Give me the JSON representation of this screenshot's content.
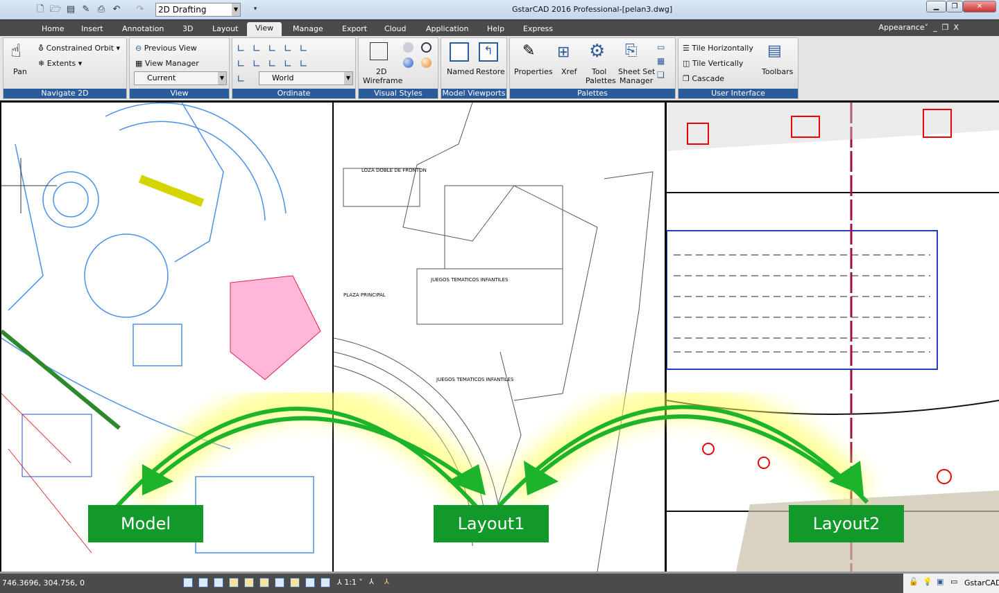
{
  "titlebar": {
    "title": "GstarCAD 2016 Professional-[pelan3.dwg]",
    "workspace": "2D Drafting",
    "quick_access": [
      "new-icon",
      "open-icon",
      "save-icon",
      "save-as-icon",
      "print-icon",
      "undo-icon",
      "redo-icon"
    ]
  },
  "tabs": [
    "Home",
    "Insert",
    "Annotation",
    "3D",
    "Layout",
    "View",
    "Manage",
    "Export",
    "Cloud",
    "Application",
    "Help",
    "Express"
  ],
  "active_tab": "View",
  "appearance": "Appearance",
  "ribbon": {
    "navigate": {
      "title": "Navigate 2D",
      "pan": "Pan",
      "orbit": "Constrained Orbit",
      "extents": "Extents"
    },
    "view": {
      "title": "View",
      "previous": "Previous View",
      "manager": "View Manager",
      "current": "Current"
    },
    "ordinate": {
      "title": "Ordinate",
      "ucs": "World"
    },
    "visual": {
      "title": "Visual Styles",
      "wire1": "2D",
      "wire2": "Wireframe"
    },
    "viewports": {
      "title": "Model Viewports",
      "named": "Named",
      "restore": "Restore"
    },
    "palettes": {
      "title": "Palettes",
      "properties": "Properties",
      "xref": "Xref",
      "tool1": "Tool",
      "tool2": "Palettes",
      "sheet1": "Sheet Set",
      "sheet2": "Manager"
    },
    "ui": {
      "title": "User Interface",
      "tileh": "Tile Horizontally",
      "tilev": "Tile Vertically",
      "cascade": "Cascade",
      "toolbars": "Toolbars"
    }
  },
  "viewports": {
    "model": "Model",
    "layout1": "Layout1",
    "layout2": "Layout2"
  },
  "drawing_text": {
    "t1": "LOZA DOBLE DE FRONTON",
    "t2": "PLAZA PRINCIPAL",
    "t3": "JUEGOS TEMATICOS INFANTILES",
    "t4": "JUEGOS TEMATICOS INFANTILES"
  },
  "status": {
    "coords": "746.3696, 304.756, 0",
    "scale": "1:1",
    "app": "GstarCAD"
  },
  "colors": {
    "accent": "#2a5b9a",
    "label_green": "#119a2a",
    "arrow_green": "#1db42b"
  }
}
